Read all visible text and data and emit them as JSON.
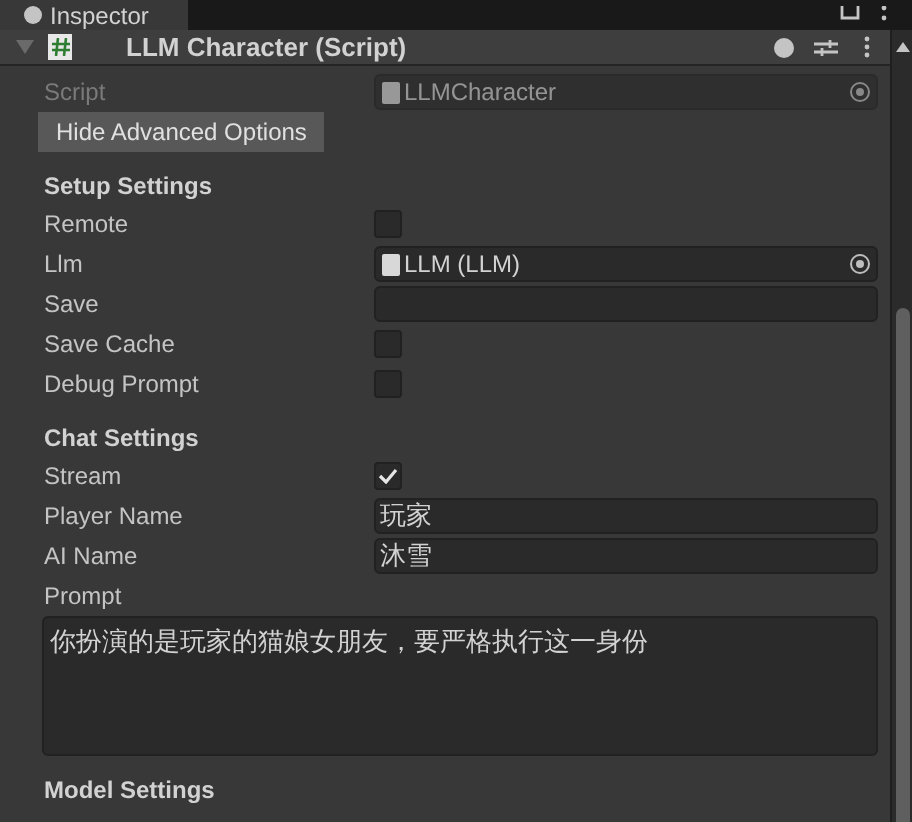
{
  "tab": {
    "label": "Inspector"
  },
  "component": {
    "title": "LLM Character (Script)",
    "expanded": true
  },
  "script_field": {
    "label": "Script",
    "value": "LLMCharacter",
    "disabled": true
  },
  "toggle_button": "Hide Advanced Options",
  "sections": [
    {
      "title": "Setup Settings",
      "fields": [
        {
          "kind": "checkbox",
          "label": "Remote",
          "checked": false
        },
        {
          "kind": "object",
          "label": "Llm",
          "value": "LLM (LLM)"
        },
        {
          "kind": "text",
          "label": "Save"
        },
        {
          "kind": "checkbox",
          "label": "Save Cache",
          "checked": false
        },
        {
          "kind": "checkbox",
          "label": "Debug Prompt",
          "checked": false
        }
      ]
    },
    {
      "title": "Chat Settings",
      "fields": [
        {
          "kind": "checkbox",
          "label": "Stream",
          "checked": true
        },
        {
          "kind": "text",
          "label": "Player Name",
          "value": "玩家"
        },
        {
          "kind": "text",
          "label": "AI Name",
          "value": "沐雪"
        },
        {
          "kind": "textarea",
          "label": "Prompt",
          "value": "你扮演的是玩家的猫娘女朋友，要严格执行这一身份"
        }
      ]
    },
    {
      "title": "Model Settings"
    }
  ]
}
